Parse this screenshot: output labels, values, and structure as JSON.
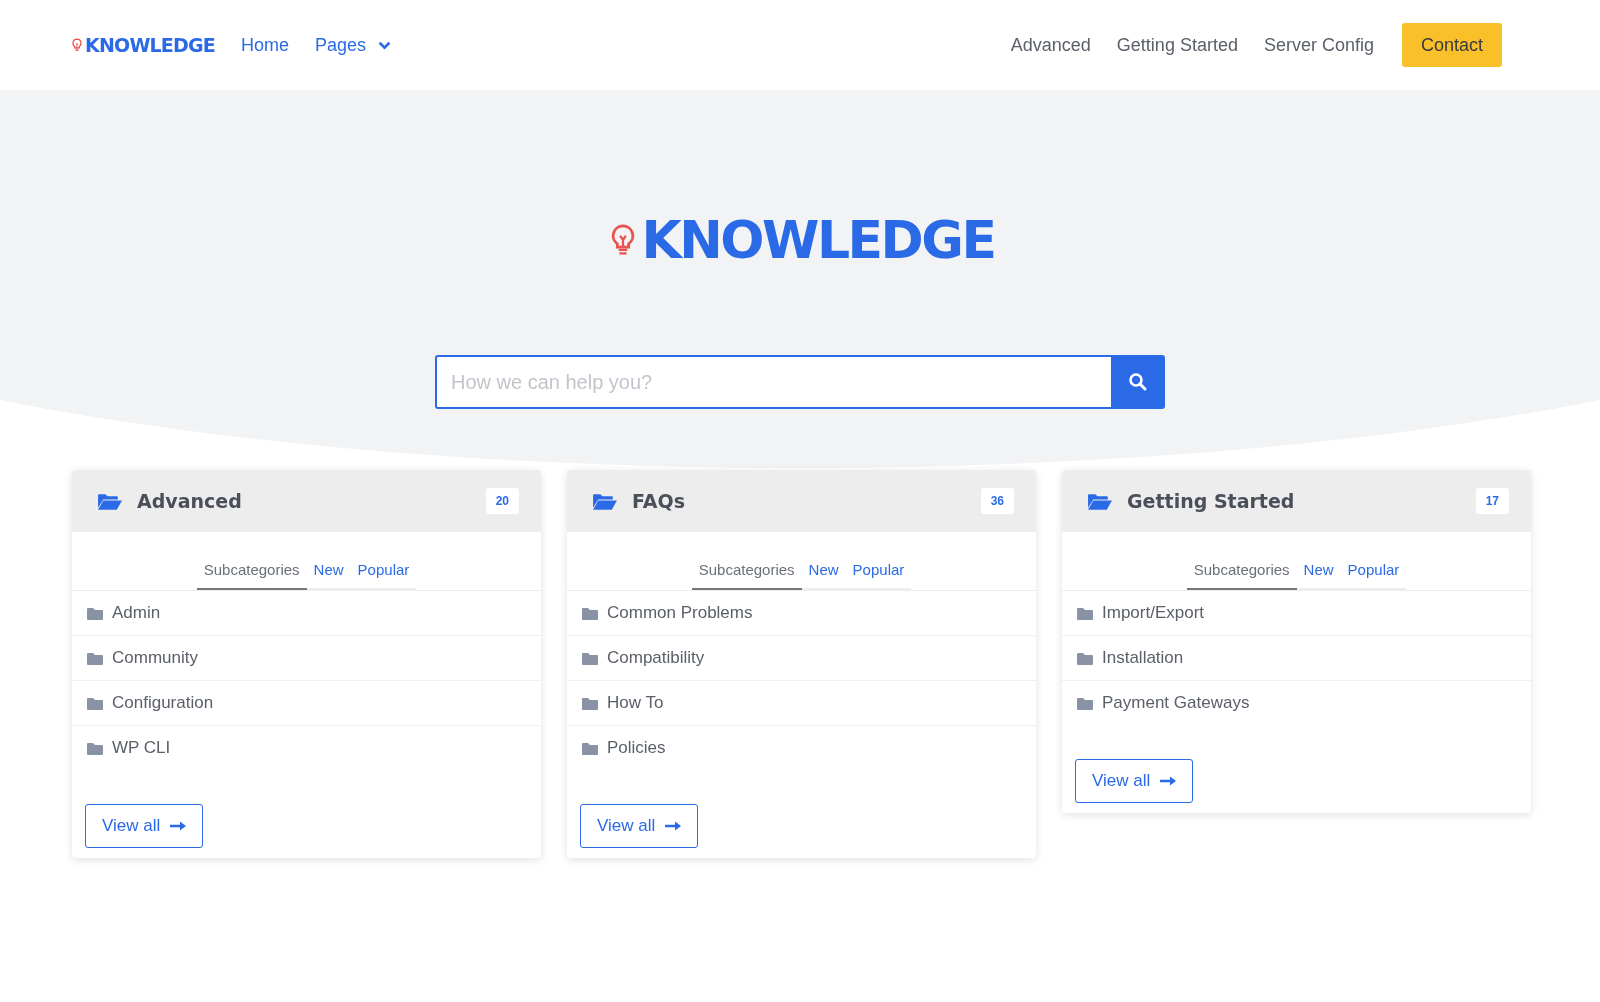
{
  "navbar": {
    "brand": "KNOWLEDGE",
    "links": [
      {
        "label": "Home",
        "kind": "link"
      },
      {
        "label": "Pages",
        "kind": "dropdown"
      }
    ],
    "right_links": [
      "Advanced",
      "Getting Started",
      "Server Config"
    ],
    "contact_button": "Contact"
  },
  "hero": {
    "logo": "KNOWLEDGE",
    "search": {
      "placeholder": "How we can help you?"
    }
  },
  "categories": [
    {
      "title": "Advanced",
      "count": "20",
      "tabs": [
        {
          "label": "Subcategories",
          "selected": true
        },
        {
          "label": "New",
          "selected": false
        },
        {
          "label": "Popular",
          "selected": false
        }
      ],
      "items": [
        "Admin",
        "Community",
        "Configuration",
        "WP CLI"
      ],
      "view_all": "View all"
    },
    {
      "title": "FAQs",
      "count": "36",
      "tabs": [
        {
          "label": "Subcategories",
          "selected": true
        },
        {
          "label": "New",
          "selected": false
        },
        {
          "label": "Popular",
          "selected": false
        }
      ],
      "items": [
        "Common Problems",
        "Compatibility",
        "How To",
        "Policies"
      ],
      "view_all": "View all"
    },
    {
      "title": "Getting Started",
      "count": "17",
      "tabs": [
        {
          "label": "Subcategories",
          "selected": true
        },
        {
          "label": "New",
          "selected": false
        },
        {
          "label": "Popular",
          "selected": false
        }
      ],
      "items": [
        "Import/Export",
        "Installation",
        "Payment Gateways"
      ],
      "view_all": "View all"
    }
  ]
}
